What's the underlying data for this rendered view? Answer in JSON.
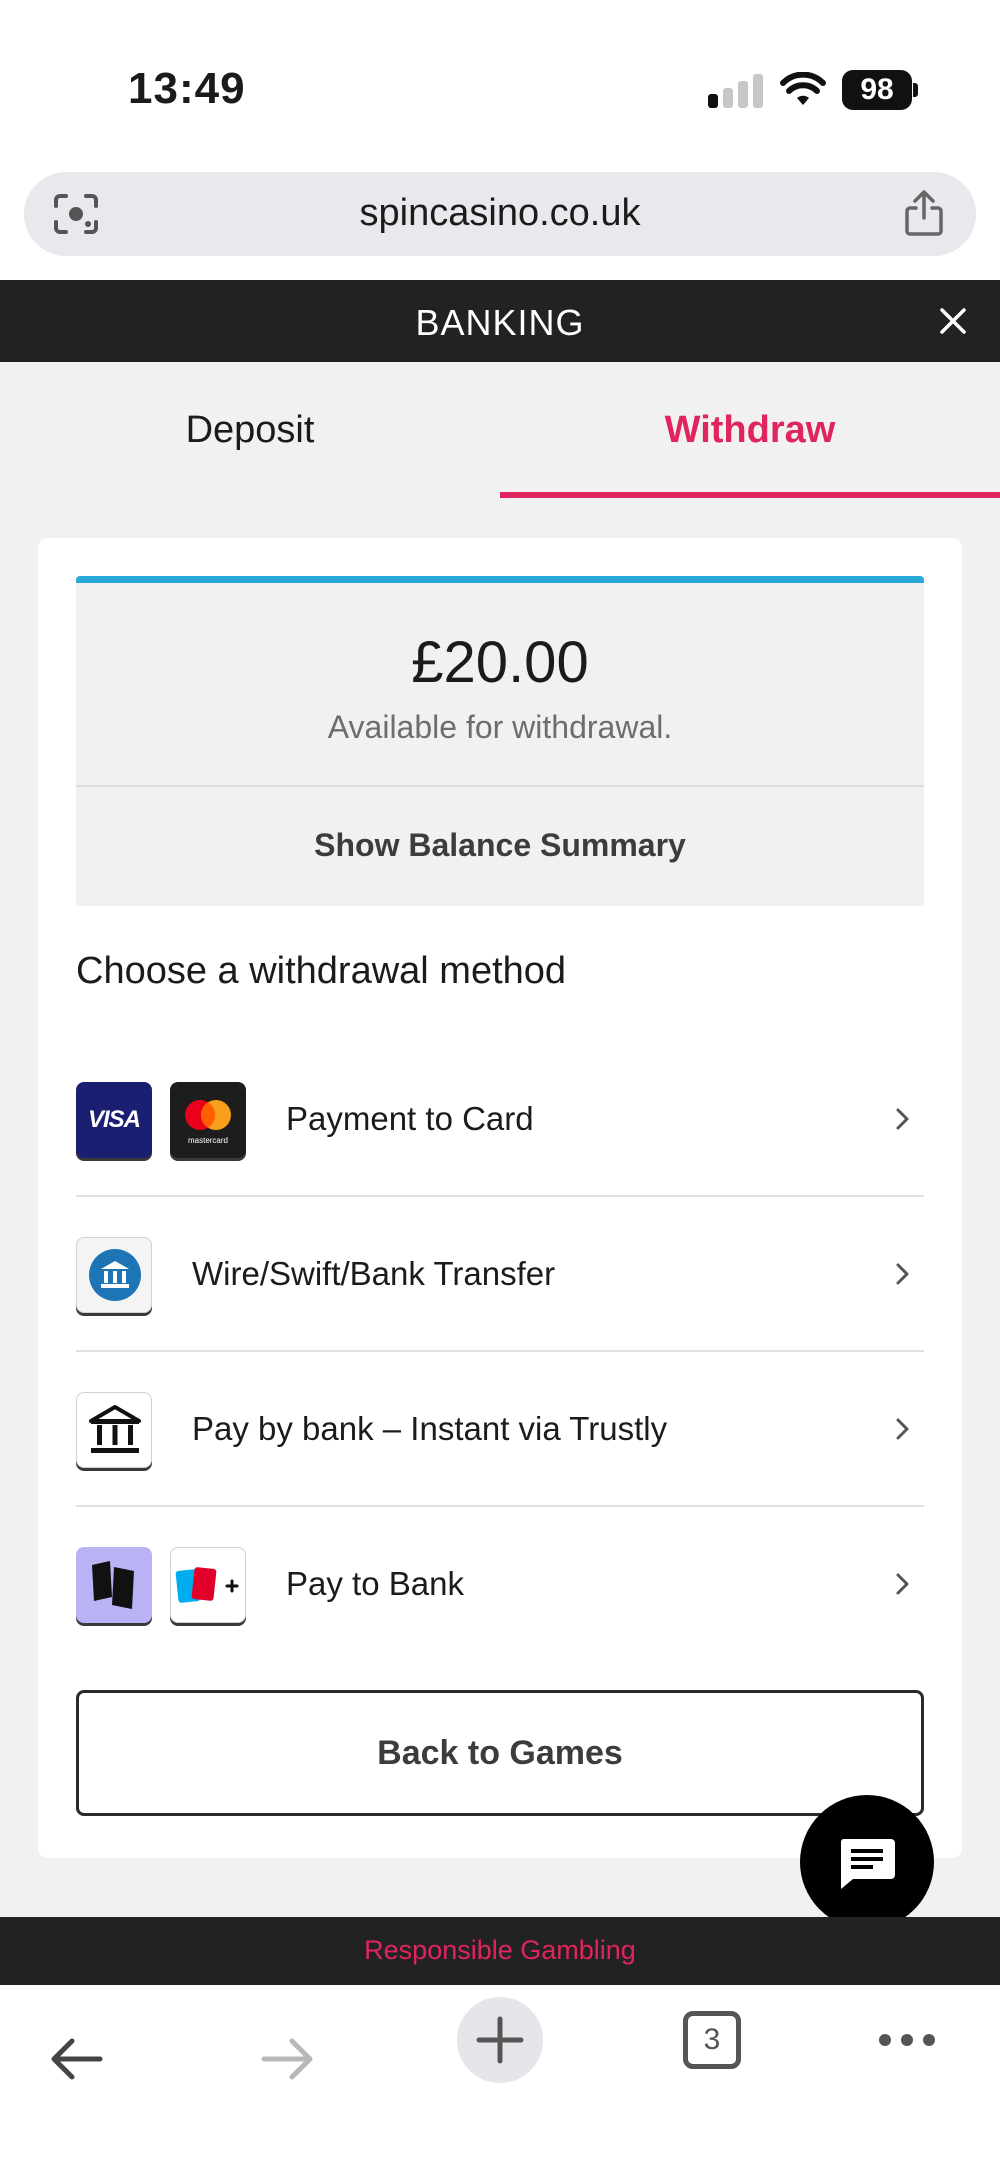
{
  "status_bar": {
    "time": "13:49",
    "battery": "98",
    "signal_bars_active": 1,
    "signal_bars_total": 4
  },
  "browser": {
    "url": "spincasino.co.uk",
    "tab_count": "3"
  },
  "header": {
    "title": "BANKING"
  },
  "tabs": [
    {
      "label": "Deposit",
      "active": false
    },
    {
      "label": "Withdraw",
      "active": true
    }
  ],
  "balance": {
    "amount": "£20.00",
    "caption": "Available for withdrawal.",
    "summary_label": "Show Balance Summary"
  },
  "methods": {
    "heading": "Choose a withdrawal method",
    "items": [
      {
        "label": "Payment to Card",
        "logos": [
          "visa-logo",
          "mastercard-logo"
        ]
      },
      {
        "label": "Wire/Swift/Bank Transfer",
        "logos": [
          "bank-transfer-logo"
        ]
      },
      {
        "label": "Pay by bank – Instant via Trustly",
        "logos": [
          "bank-building-logo"
        ]
      },
      {
        "label": "Pay to Bank",
        "logos": [
          "pay-to-bank-logo",
          "uk-banks-logo"
        ]
      }
    ]
  },
  "logo_text": {
    "visa": "VISA",
    "mastercard": "mastercard"
  },
  "back_button": "Back to Games",
  "footer": {
    "responsible_gambling": "Responsible Gambling"
  },
  "colors": {
    "accent": "#e0245e",
    "header_bg": "#222222",
    "balance_top": "#2aa8d8",
    "visa_bg": "#1a1f71"
  }
}
